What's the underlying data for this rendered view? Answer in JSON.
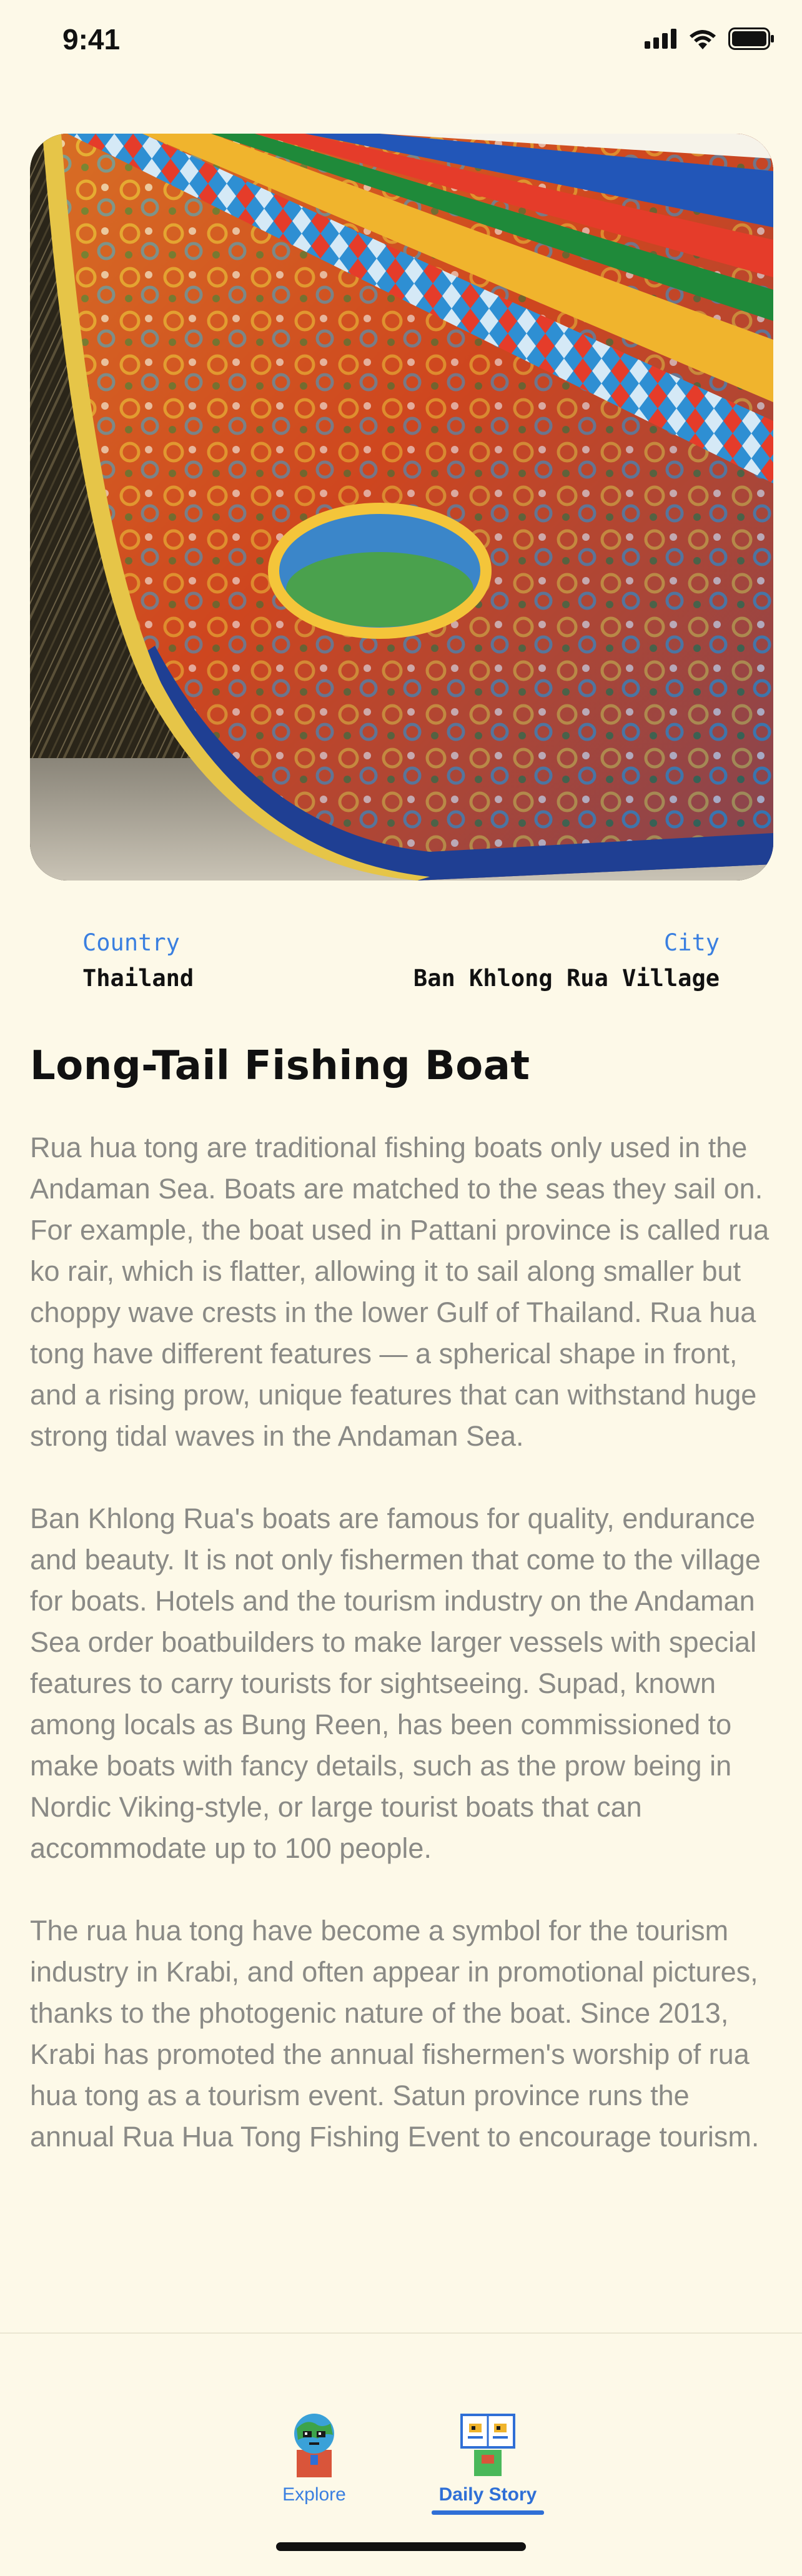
{
  "status_bar": {
    "time": "9:41",
    "icons": [
      "cellular-signal-icon",
      "wifi-icon",
      "battery-icon"
    ]
  },
  "hero": {
    "image": "painted-boat-hull-photo"
  },
  "meta": {
    "country_label": "Country",
    "country_value": "Thailand",
    "city_label": "City",
    "city_value": "Ban Khlong Rua Village"
  },
  "article": {
    "title": "Long-Tail Fishing Boat",
    "paragraphs": [
      "Rua hua tong are traditional fishing boats only used in the Andaman Sea. Boats are matched to the seas they sail on. For example, the boat used in Pattani province is called rua ko rair, which is flatter, allowing it to sail along smaller but choppy wave crests in the lower Gulf of Thailand. Rua hua tong have different features — a spherical shape in front, and a rising prow, unique features that can withstand huge strong tidal waves in the Andaman Sea.",
      "Ban Khlong Rua's boats are famous for quality, endurance and beauty. It is not only fishermen that come to the village for boats. Hotels and the tourism industry on the Andaman Sea order boatbuilders to make larger vessels with special features to carry tourists for sightseeing. Supad, known among locals as Bung Reen, has been commissioned to make boats with fancy details, such as the prow being in Nordic Viking-style, or large tourist boats that can accommodate up to 100 people.",
      "The rua hua tong have become a symbol for the tourism industry in Krabi, and often appear in promotional pictures, thanks to the photogenic nature of the boat. Since 2013, Krabi has promoted the annual fishermen's worship of rua hua tong as a tourism event. Satun province runs the annual Rua Hua Tong Fishing Event to encourage tourism."
    ]
  },
  "tabbar": {
    "tabs": [
      {
        "label": "Explore",
        "icon": "globe-character-icon",
        "selected": false
      },
      {
        "label": "Daily Story",
        "icon": "book-character-icon",
        "selected": true
      }
    ],
    "accent_color": "#2f6fd6"
  },
  "colors": {
    "background": "#fdf9e8",
    "accent": "#3a7fe0",
    "body_text": "#8a8a86"
  }
}
